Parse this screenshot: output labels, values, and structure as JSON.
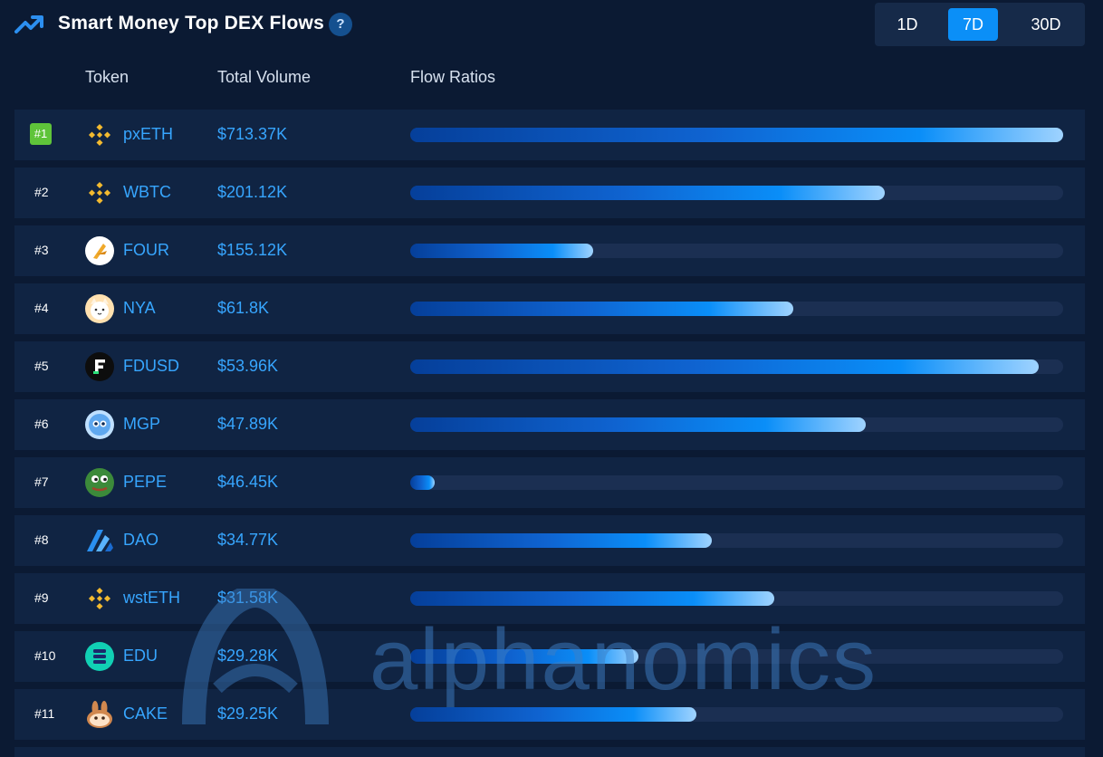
{
  "header": {
    "title": "Smart Money Top DEX Flows",
    "help": "?",
    "trend_icon": "trending-up-icon",
    "tabs": [
      {
        "label": "1D",
        "active": false
      },
      {
        "label": "7D",
        "active": true
      },
      {
        "label": "30D",
        "active": false
      }
    ]
  },
  "columns": {
    "token": "Token",
    "volume": "Total Volume",
    "flow": "Flow Ratios"
  },
  "rows": [
    {
      "rank": "#1",
      "symbol": "pxETH",
      "volume": "$713.37K",
      "ratio": 1.0,
      "icon": "bnb-icon"
    },
    {
      "rank": "#2",
      "symbol": "WBTC",
      "volume": "$201.12K",
      "ratio": 0.727,
      "icon": "bnb-icon"
    },
    {
      "rank": "#3",
      "symbol": "FOUR",
      "volume": "$155.12K",
      "ratio": 0.28,
      "icon": "four-logo-icon"
    },
    {
      "rank": "#4",
      "symbol": "NYA",
      "volume": "$61.8K",
      "ratio": 0.586,
      "icon": "nya-cat-icon"
    },
    {
      "rank": "#5",
      "symbol": "FDUSD",
      "volume": "$53.96K",
      "ratio": 0.963,
      "icon": "fdusd-icon"
    },
    {
      "rank": "#6",
      "symbol": "MGP",
      "volume": "$47.89K",
      "ratio": 0.698,
      "icon": "mgp-icon"
    },
    {
      "rank": "#7",
      "symbol": "PEPE",
      "volume": "$46.45K",
      "ratio": 0.037,
      "icon": "pepe-frog-icon"
    },
    {
      "rank": "#8",
      "symbol": "DAO",
      "volume": "$34.77K",
      "ratio": 0.462,
      "icon": "dao-icon"
    },
    {
      "rank": "#9",
      "symbol": "wstETH",
      "volume": "$31.58K",
      "ratio": 0.558,
      "icon": "bnb-icon"
    },
    {
      "rank": "#10",
      "symbol": "EDU",
      "volume": "$29.28K",
      "ratio": 0.35,
      "icon": "edu-icon"
    },
    {
      "rank": "#11",
      "symbol": "CAKE",
      "volume": "$29.25K",
      "ratio": 0.438,
      "icon": "pancake-bunny-icon"
    }
  ],
  "watermark": {
    "text": "alphanomics"
  },
  "colors": {
    "accent": "#0b8ff7",
    "rank_first": "#5fc43a",
    "text_link": "#37a6ff",
    "background": "#0b1a33"
  }
}
